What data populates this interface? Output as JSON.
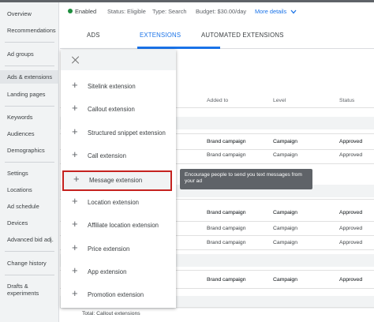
{
  "sidebar": {
    "items": [
      {
        "label": "Overview"
      },
      {
        "label": "Recommendations"
      },
      {
        "label": "Ad groups"
      },
      {
        "label": "Ads & extensions"
      },
      {
        "label": "Landing pages"
      },
      {
        "label": "Keywords"
      },
      {
        "label": "Audiences"
      },
      {
        "label": "Demographics"
      },
      {
        "label": "Settings"
      },
      {
        "label": "Locations"
      },
      {
        "label": "Ad schedule"
      },
      {
        "label": "Devices"
      },
      {
        "label": "Advanced bid adj."
      },
      {
        "label": "Change history"
      },
      {
        "label": "Drafts &"
      },
      {
        "label": "experiments"
      }
    ],
    "active_item": "Ads & extensions"
  },
  "status": {
    "enabled": "Enabled",
    "status_text": "Status: Eligible",
    "type_text": "Type: Search",
    "budget_text": "Budget: $30.00/day",
    "more_details": "More details",
    "enabled_color": "#1e8e3e"
  },
  "tabs": [
    {
      "label": "ADS"
    },
    {
      "label": "EXTENSIONS"
    },
    {
      "label": "AUTOMATED EXTENSIONS"
    }
  ],
  "active_tab": "EXTENSIONS",
  "table": {
    "columns": {
      "added_to": "Added to",
      "level": "Level",
      "status": "Status"
    },
    "rows": [
      {
        "added_to": "Brand campaign",
        "level": "Campaign",
        "status": "Approved"
      },
      {
        "added_to": "Brand campaign",
        "level": "Campaign",
        "status": "Approved"
      },
      {
        "added_to": "Brand campaign",
        "level": "Campaign",
        "status": "Approved"
      },
      {
        "added_to": "Brand campaign",
        "level": "Campaign",
        "status": "Approved"
      },
      {
        "added_to": "Brand campaign",
        "level": "Campaign",
        "status": "Approved"
      },
      {
        "added_to": "Brand campaign",
        "level": "Campaign",
        "status": "Approved"
      },
      {
        "added_to": "Brand campaign",
        "level": "Campaign",
        "status": "Approved"
      },
      {
        "added_to": "Brand campaign",
        "level": "Campaign",
        "status": "Approved"
      },
      {
        "added_to": "Brand campaign",
        "level": "Campaign",
        "status": "Approved"
      }
    ],
    "total": "Total: Callout extensions"
  },
  "menu": {
    "items": [
      {
        "label": "Sitelink extension"
      },
      {
        "label": "Callout extension"
      },
      {
        "label": "Structured snippet extension"
      },
      {
        "label": "Call extension"
      },
      {
        "label": "Message extension"
      },
      {
        "label": "Location extension"
      },
      {
        "label": "Affiliate location extension"
      },
      {
        "label": "Price extension"
      },
      {
        "label": "App extension"
      },
      {
        "label": "Promotion extension"
      }
    ],
    "highlighted_item": "Message extension",
    "highlight_color": "#c5221f",
    "plus_glyph": "+"
  },
  "tooltip": {
    "text": "Encourage people to send you text messages from your ad"
  },
  "accent_color": "#1a73e8"
}
